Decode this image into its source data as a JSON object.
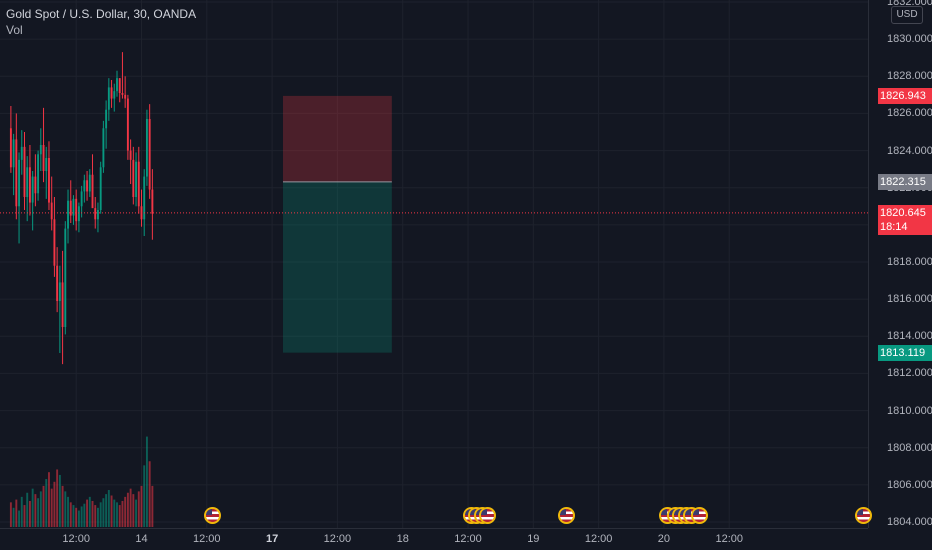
{
  "legend": {
    "symbol": "Gold Spot / U.S. Dollar, 30, OANDA",
    "volume_label": "Vol"
  },
  "price_axis": {
    "currency": "USD",
    "ticks": [
      "1832.000",
      "1830.000",
      "1828.000",
      "1826.000",
      "1824.000",
      "1822.000",
      "1820.000",
      "1818.000",
      "1816.000",
      "1814.000",
      "1812.000",
      "1810.000",
      "1808.000",
      "1806.000",
      "1804.000"
    ],
    "min": 1804,
    "max": 1832
  },
  "price_tags": {
    "stop": {
      "label": "1826.943",
      "value": 1826.943,
      "color": "#f23645"
    },
    "entry": {
      "label": "1822.315",
      "value": 1822.315,
      "color": "#787b86"
    },
    "last": {
      "label": "1820.645",
      "countdown": "18:14",
      "value": 1820.645,
      "color": "#f23645"
    },
    "target": {
      "label": "1813.119",
      "value": 1813.119,
      "color": "#089981"
    }
  },
  "time_axis": {
    "ticks": [
      {
        "label": "12:00",
        "bold": false
      },
      {
        "label": "14",
        "bold": false
      },
      {
        "label": "12:00",
        "bold": false
      },
      {
        "label": "17",
        "bold": true
      },
      {
        "label": "12:00",
        "bold": false
      },
      {
        "label": "18",
        "bold": false
      },
      {
        "label": "12:00",
        "bold": false
      },
      {
        "label": "19",
        "bold": false
      },
      {
        "label": "12:00",
        "bold": false
      },
      {
        "label": "20",
        "bold": false
      },
      {
        "label": "12:00",
        "bold": false
      }
    ]
  },
  "colors": {
    "up": "#089981",
    "down": "#f23645",
    "background": "#131722",
    "grid": "#1e222d",
    "stop_zone": "rgba(242,54,69,0.25)",
    "target_zone": "rgba(8,153,129,0.25)"
  },
  "events": {
    "icon": "us-flag-icon",
    "count": 13
  },
  "chart_data": {
    "type": "candlestick",
    "symbol": "Gold Spot / U.S. Dollar",
    "interval": "30",
    "source": "OANDA",
    "ylim": [
      1804,
      1832
    ],
    "candles": [
      [
        1825.2,
        1826.4,
        1822.8,
        1823.1
      ],
      [
        1823.1,
        1824.9,
        1821.6,
        1824.6
      ],
      [
        1824.6,
        1826.0,
        1820.3,
        1821.0
      ],
      [
        1821.0,
        1823.9,
        1819.0,
        1823.5
      ],
      [
        1823.5,
        1825.1,
        1822.7,
        1824.2
      ],
      [
        1824.2,
        1825.0,
        1820.8,
        1821.5
      ],
      [
        1821.5,
        1823.7,
        1820.2,
        1823.1
      ],
      [
        1823.1,
        1824.3,
        1820.5,
        1821.2
      ],
      [
        1821.2,
        1822.9,
        1819.7,
        1822.6
      ],
      [
        1822.6,
        1823.8,
        1821.0,
        1821.7
      ],
      [
        1821.7,
        1824.0,
        1821.3,
        1823.8
      ],
      [
        1823.8,
        1825.2,
        1822.9,
        1824.3
      ],
      [
        1824.3,
        1826.3,
        1822.3,
        1822.9
      ],
      [
        1822.9,
        1824.2,
        1821.4,
        1823.6
      ],
      [
        1823.6,
        1824.5,
        1820.8,
        1821.2
      ],
      [
        1821.2,
        1822.6,
        1819.7,
        1820.3
      ],
      [
        1820.3,
        1821.5,
        1817.2,
        1817.8
      ],
      [
        1817.8,
        1818.8,
        1815.3,
        1815.9
      ],
      [
        1815.9,
        1817.8,
        1813.1,
        1816.9
      ],
      [
        1816.9,
        1818.6,
        1812.5,
        1814.5
      ],
      [
        1814.5,
        1820.2,
        1814.1,
        1819.8
      ],
      [
        1819.8,
        1821.9,
        1819.0,
        1821.3
      ],
      [
        1821.3,
        1822.4,
        1820.1,
        1820.5
      ],
      [
        1820.5,
        1821.6,
        1820.0,
        1821.4
      ],
      [
        1821.4,
        1821.9,
        1819.7,
        1820.2
      ],
      [
        1820.2,
        1821.2,
        1819.6,
        1821.0
      ],
      [
        1821.0,
        1822.1,
        1820.4,
        1821.8
      ],
      [
        1821.8,
        1822.7,
        1821.2,
        1822.4
      ],
      [
        1822.4,
        1822.9,
        1821.3,
        1821.8
      ],
      [
        1821.8,
        1823.0,
        1821.5,
        1822.7
      ],
      [
        1822.7,
        1823.8,
        1821.9,
        1820.9
      ],
      [
        1820.9,
        1821.5,
        1819.8,
        1820.3
      ],
      [
        1820.3,
        1821.2,
        1819.6,
        1820.8
      ],
      [
        1820.8,
        1823.4,
        1820.6,
        1823.1
      ],
      [
        1823.1,
        1825.6,
        1822.8,
        1825.2
      ],
      [
        1825.2,
        1826.7,
        1824.1,
        1826.2
      ],
      [
        1826.2,
        1827.9,
        1825.6,
        1827.4
      ],
      [
        1827.4,
        1827.8,
        1826.3,
        1826.8
      ],
      [
        1826.8,
        1827.6,
        1826.1,
        1827.2
      ],
      [
        1827.2,
        1828.3,
        1826.9,
        1827.9
      ],
      [
        1827.9,
        1827.9,
        1826.6,
        1827.1
      ],
      [
        1827.1,
        1829.3,
        1826.8,
        1827.0
      ],
      [
        1827.0,
        1828.0,
        1826.3,
        1826.8
      ],
      [
        1826.8,
        1827.0,
        1823.5,
        1824.0
      ],
      [
        1824.0,
        1824.6,
        1822.2,
        1823.5
      ],
      [
        1823.5,
        1824.2,
        1821.1,
        1821.5
      ],
      [
        1821.5,
        1823.9,
        1821.0,
        1823.4
      ],
      [
        1823.4,
        1824.2,
        1820.6,
        1821.0
      ],
      [
        1821.0,
        1821.9,
        1819.9,
        1820.3
      ],
      [
        1820.3,
        1823.0,
        1819.4,
        1822.6
      ],
      [
        1822.6,
        1826.2,
        1822.1,
        1825.7
      ],
      [
        1825.7,
        1826.5,
        1821.4,
        1821.9
      ],
      [
        1821.9,
        1823.0,
        1819.2,
        1820.6
      ]
    ],
    "volume_ylim": [
      0,
      100
    ],
    "volume": [
      18,
      14,
      20,
      12,
      22,
      16,
      25,
      19,
      28,
      24,
      21,
      26,
      30,
      35,
      40,
      28,
      33,
      42,
      38,
      30,
      26,
      22,
      18,
      16,
      14,
      12,
      15,
      17,
      20,
      22,
      19,
      16,
      14,
      18,
      21,
      24,
      27,
      23,
      20,
      18,
      16,
      19,
      22,
      25,
      28,
      24,
      20,
      26,
      30,
      45,
      66,
      48,
      30
    ],
    "position": {
      "stop": 1826.943,
      "entry": 1822.315,
      "target": 1813.119,
      "time_start": "2021-06-16T02:00",
      "time_end": "2021-06-16T22:00"
    },
    "last_price": 1820.645,
    "xlim": [
      "2021-06-13T22:00",
      "2021-06-20T13:30"
    ],
    "time_ticks": [
      {
        "label": "12:00",
        "time": "2021-06-14T12:00"
      },
      {
        "label": "14",
        "time": "2021-06-15T00:00"
      },
      {
        "label": "12:00",
        "time": "2021-06-15T12:00"
      },
      {
        "label": "17",
        "time": "2021-06-16T00:00"
      },
      {
        "label": "12:00",
        "time": "2021-06-16T12:00"
      },
      {
        "label": "18",
        "time": "2021-06-17T00:00"
      },
      {
        "label": "12:00",
        "time": "2021-06-17T12:00"
      },
      {
        "label": "19",
        "time": "2021-06-18T00:00"
      },
      {
        "label": "12:00",
        "time": "2021-06-18T12:00"
      },
      {
        "label": "20",
        "time": "2021-06-19T00:00"
      },
      {
        "label": "12:00",
        "time": "2021-06-19T12:00"
      }
    ],
    "events": [
      "2021-06-15T13:00",
      "2021-06-17T12:30",
      "2021-06-17T13:30",
      "2021-06-17T14:30",
      "2021-06-17T15:30",
      "2021-06-18T06:00",
      "2021-06-19T00:30",
      "2021-06-19T02:00",
      "2021-06-19T03:00",
      "2021-06-19T04:00",
      "2021-06-19T05:00",
      "2021-06-19T06:30",
      "2021-06-20T12:30"
    ]
  }
}
